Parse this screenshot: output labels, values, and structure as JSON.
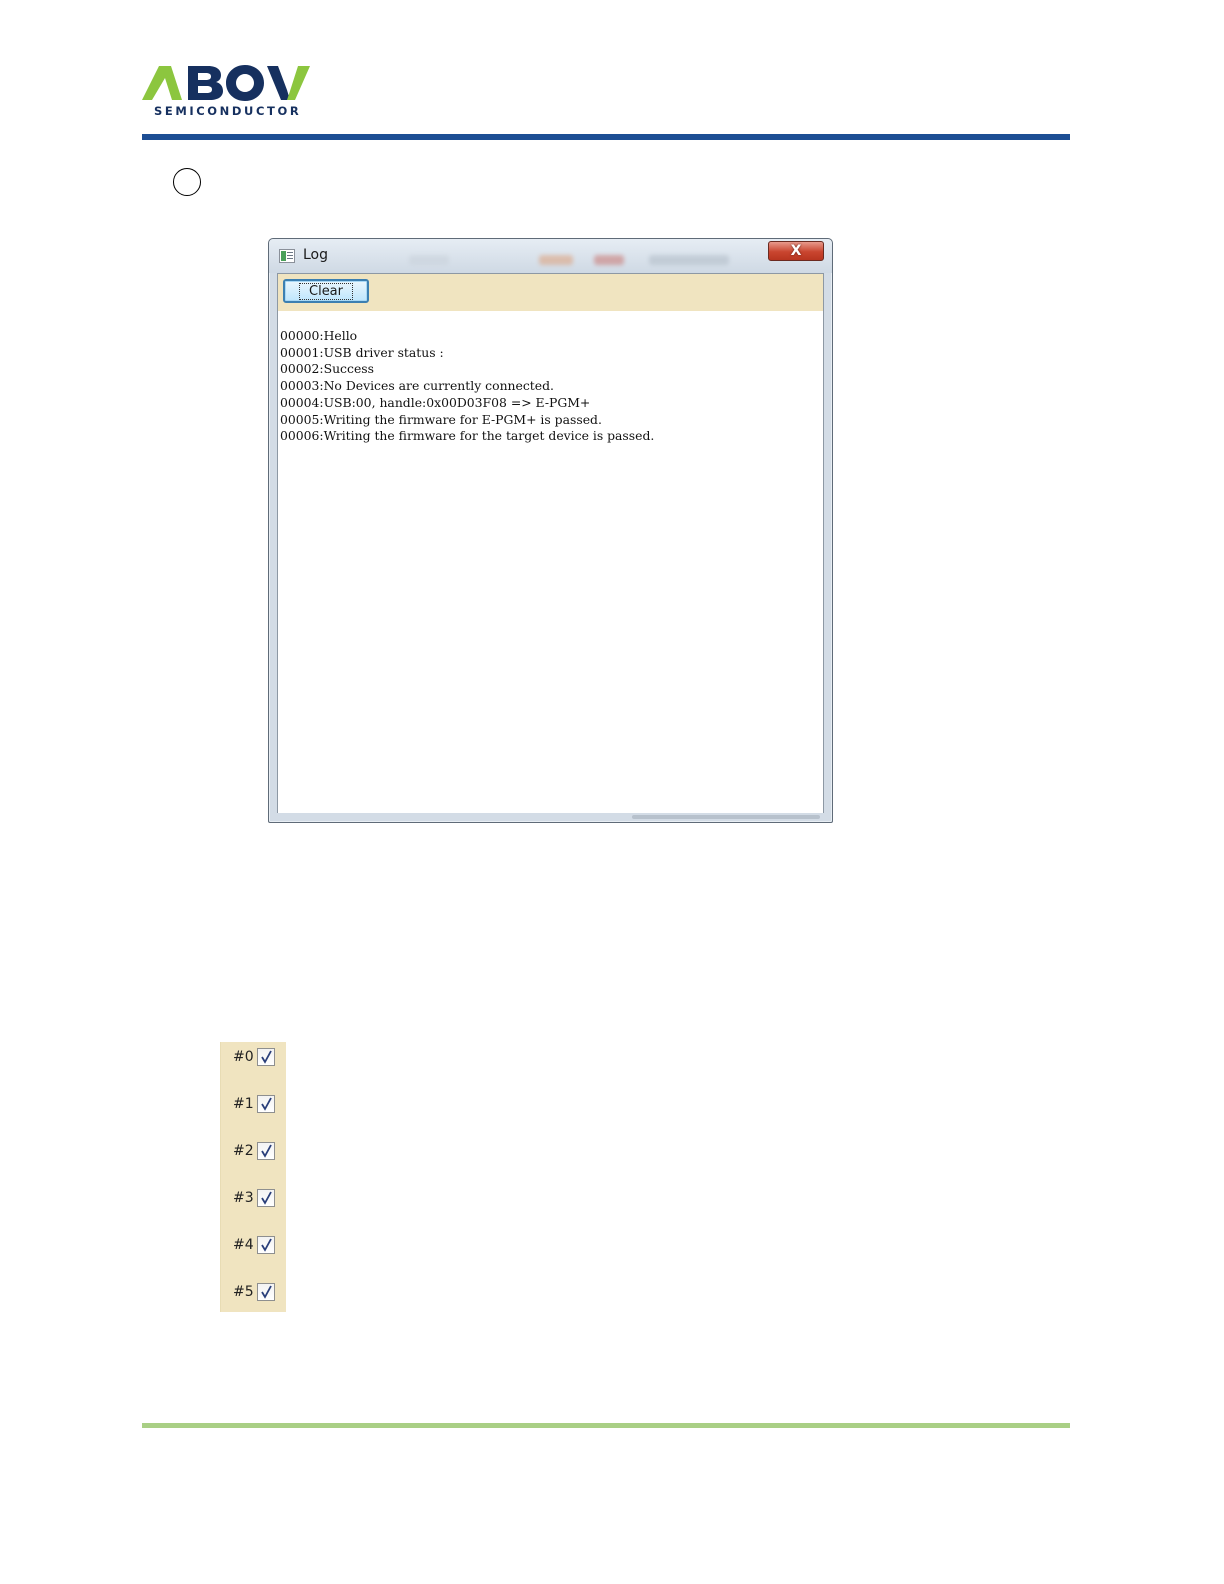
{
  "header": {
    "logo_text": "ABOV",
    "logo_subtext": "SEMICONDUCTOR"
  },
  "log_window": {
    "title": "Log",
    "close_glyph": "X",
    "clear_label": "Clear",
    "lines": [
      "00000:Hello",
      "00001:USB driver status :",
      "00002:Success",
      "00003:No Devices are currently connected.",
      "00004:USB:00, handle:0x00D03F08 => E-PGM+",
      "00005:Writing the firmware for E-PGM+ is passed.",
      "00006:Writing the firmware for the target device is passed."
    ]
  },
  "channels": [
    {
      "label": "#0",
      "checked": true
    },
    {
      "label": "#1",
      "checked": true
    },
    {
      "label": "#2",
      "checked": true
    },
    {
      "label": "#3",
      "checked": true
    },
    {
      "label": "#4",
      "checked": true
    },
    {
      "label": "#5",
      "checked": true
    }
  ],
  "colors": {
    "logo_green": "#8cc63f",
    "logo_navy": "#16305f",
    "header_rule": "#1d4e94",
    "footer_rule": "#a9cf85",
    "toolbar_bg": "#f0e4c0"
  }
}
